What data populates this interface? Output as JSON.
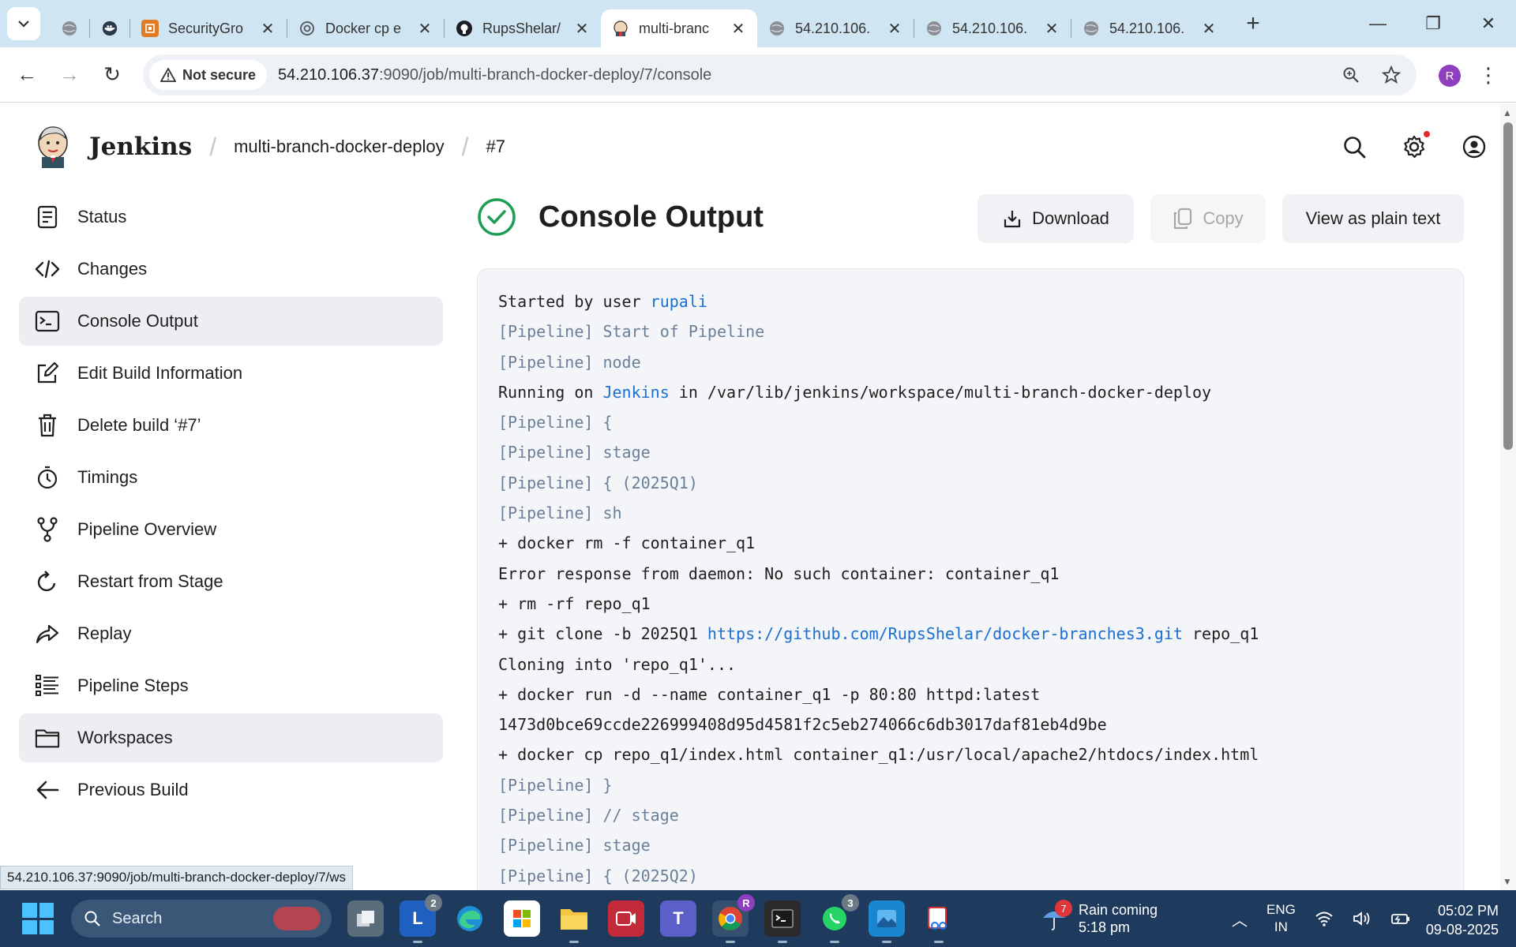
{
  "browser": {
    "tabs": [
      {
        "title": "",
        "icon": "globe-icon"
      },
      {
        "title": "",
        "icon": "docker-icon"
      },
      {
        "title": "SecurityGro",
        "icon": "aws-icon"
      },
      {
        "title": "Docker cp e",
        "icon": "openai-icon"
      },
      {
        "title": "RupsShelar/",
        "icon": "github-icon"
      },
      {
        "title": "multi-branc",
        "icon": "jenkins-icon",
        "active": true
      },
      {
        "title": "54.210.106.",
        "icon": "globe-icon"
      },
      {
        "title": "54.210.106.",
        "icon": "globe-icon"
      },
      {
        "title": "54.210.106.",
        "icon": "globe-icon"
      }
    ],
    "security_label": "Not secure",
    "url_host": "54.210.106.37",
    "url_rest": ":9090/job/multi-branch-docker-deploy/7/console",
    "profile_initial": "R",
    "status_url": "54.210.106.37:9090/job/multi-branch-docker-deploy/7/ws"
  },
  "header": {
    "brand": "Jenkins",
    "breadcrumbs": [
      "multi-branch-docker-deploy",
      "#7"
    ]
  },
  "sidebar": {
    "items": [
      {
        "label": "Status",
        "icon": "status-icon"
      },
      {
        "label": "Changes",
        "icon": "code-icon"
      },
      {
        "label": "Console Output",
        "icon": "terminal-icon",
        "selected": true
      },
      {
        "label": "Edit Build Information",
        "icon": "edit-icon"
      },
      {
        "label": "Delete build ‘#7’",
        "icon": "trash-icon"
      },
      {
        "label": "Timings",
        "icon": "stopwatch-icon"
      },
      {
        "label": "Pipeline Overview",
        "icon": "branch-icon"
      },
      {
        "label": "Restart from Stage",
        "icon": "restart-icon"
      },
      {
        "label": "Replay",
        "icon": "replay-icon"
      },
      {
        "label": "Pipeline Steps",
        "icon": "list-icon"
      },
      {
        "label": "Workspaces",
        "icon": "folder-icon",
        "hovered": true
      },
      {
        "label": "Previous Build",
        "icon": "arrow-left-icon"
      }
    ]
  },
  "main": {
    "title": "Console Output",
    "download_label": "Download",
    "copy_label": "Copy",
    "plain_text_label": "View as plain text"
  },
  "console": {
    "line_started_prefix": "Started by user ",
    "line_started_user": "rupali",
    "line_pipeline_start": "[Pipeline] Start of Pipeline",
    "line_pipeline_node": "[Pipeline] node",
    "line_running_prefix": "Running on ",
    "line_running_link": "Jenkins",
    "line_running_suffix": " in /var/lib/jenkins/workspace/multi-branch-docker-deploy",
    "line_open_brace": "[Pipeline] {",
    "line_stage": "[Pipeline] stage",
    "line_stage_q1": "[Pipeline] { (2025Q1)",
    "line_sh": "[Pipeline] sh",
    "line_docker_rm": "+ docker rm -f container_q1",
    "line_error": "Error response from daemon: No such container: container_q1",
    "line_rm_repo": "+ rm -rf repo_q1",
    "line_git_prefix": "+ git clone -b 2025Q1 ",
    "line_git_link": "https://github.com/RupsShelar/docker-branches3.git",
    "line_git_suffix": " repo_q1",
    "line_cloning": "Cloning into 'repo_q1'...",
    "line_docker_run": "+ docker run -d --name container_q1 -p 80:80 httpd:latest",
    "line_hash": "1473d0bce69ccde226999408d95d4581f2c5eb274066c6db3017daf81eb4d9be",
    "line_docker_cp": "+ docker cp repo_q1/index.html container_q1:/usr/local/apache2/htdocs/index.html",
    "line_close_brace": "[Pipeline] }",
    "line_stage_comment": "[Pipeline] // stage",
    "line_stage2": "[Pipeline] stage",
    "line_stage_q2": "[Pipeline] { (2025Q2)"
  },
  "taskbar": {
    "search_label": "Search",
    "weather_title": "Rain coming",
    "weather_time": "5:18 pm",
    "weather_badge": "7",
    "lang_1": "ENG",
    "lang_2": "IN",
    "time": "05:02 PM",
    "date": "09-08-2025",
    "badge_l": "2",
    "badge_whatsapp": "3",
    "badge_chrome": "R"
  },
  "colors": {
    "accent_link": "#1a6fd1",
    "success_green": "#1f9d55",
    "tab_strip": "#cfe6f2",
    "taskbar": "#1e3a5c"
  }
}
